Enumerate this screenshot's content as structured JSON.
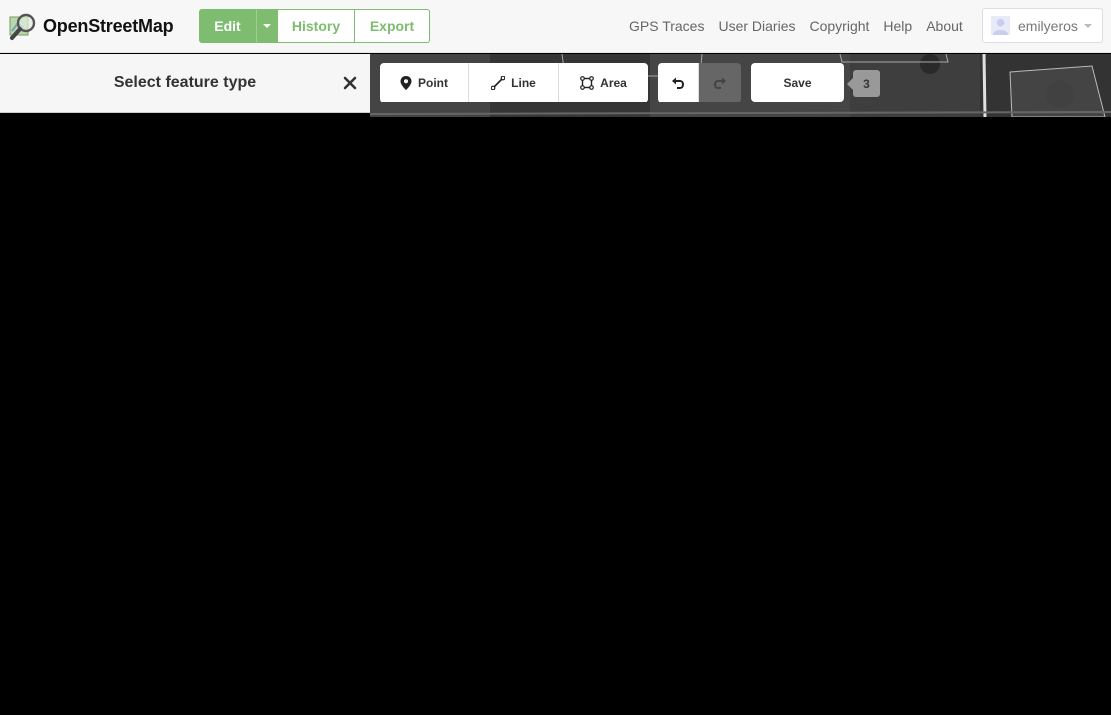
{
  "brand": {
    "name": "OpenStreetMap"
  },
  "header": {
    "edit_label": "Edit",
    "history_label": "History",
    "export_label": "Export",
    "nav_links": [
      "GPS Traces",
      "User Diaries",
      "Copyright",
      "Help",
      "About"
    ],
    "username": "emilyeros"
  },
  "sidebar": {
    "title": "Select feature type"
  },
  "toolbar": {
    "point_label": "Point",
    "line_label": "Line",
    "area_label": "Area",
    "save_label": "Save",
    "save_count": "3"
  },
  "colors": {
    "accent": "#7ebc6f",
    "map_bg": "#3a3a3a"
  },
  "icons": [
    "magnifier-map-logo",
    "caret-down-icon",
    "user-avatar-icon",
    "close-icon",
    "pin-icon",
    "line-icon",
    "area-icon",
    "undo-icon",
    "redo-icon"
  ]
}
